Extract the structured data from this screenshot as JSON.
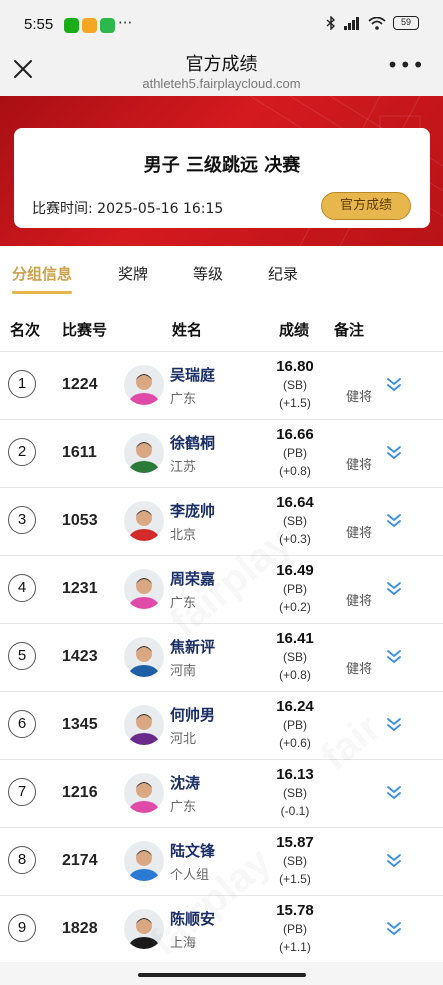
{
  "status_bar": {
    "time": "5:55",
    "more": "···",
    "battery": "59",
    "app_colors": [
      "#1aad19",
      "#f5a623",
      "#2db84d"
    ]
  },
  "header": {
    "title": "官方成绩",
    "url": "athleteh5.fairplaycloud.com"
  },
  "event": {
    "title": "男子 三级跳远 决赛",
    "time": "比赛时间: 2025-05-16 16:15",
    "official_button": "官方成绩"
  },
  "tabs": [
    "分组信息",
    "奖牌",
    "等级",
    "纪录"
  ],
  "table_headers": {
    "rank": "名次",
    "bib": "比赛号",
    "name": "姓名",
    "result": "成绩",
    "note": "备注"
  },
  "rows": [
    {
      "rank": "1",
      "bib": "1224",
      "name": "吴瑞庭",
      "team": "广东",
      "mark": "16.80",
      "tag": "(SB)",
      "wind": "(+1.5)",
      "note": "健将",
      "shirt": "#e04aa8"
    },
    {
      "rank": "2",
      "bib": "1611",
      "name": "徐鹤桐",
      "team": "江苏",
      "mark": "16.66",
      "tag": "(PB)",
      "wind": "(+0.8)",
      "note": "健将",
      "shirt": "#2c7a3a"
    },
    {
      "rank": "3",
      "bib": "1053",
      "name": "李庞帅",
      "team": "北京",
      "mark": "16.64",
      "tag": "(SB)",
      "wind": "(+0.3)",
      "note": "健将",
      "shirt": "#d42a2a"
    },
    {
      "rank": "4",
      "bib": "1231",
      "name": "周荣嘉",
      "team": "广东",
      "mark": "16.49",
      "tag": "(PB)",
      "wind": "(+0.2)",
      "note": "健将",
      "shirt": "#e04aa8"
    },
    {
      "rank": "5",
      "bib": "1423",
      "name": "焦新评",
      "team": "河南",
      "mark": "16.41",
      "tag": "(SB)",
      "wind": "(+0.8)",
      "note": "健将",
      "shirt": "#1f5fa8"
    },
    {
      "rank": "6",
      "bib": "1345",
      "name": "何帅男",
      "team": "河北",
      "mark": "16.24",
      "tag": "(PB)",
      "wind": "(+0.6)",
      "note": "",
      "shirt": "#6a2a8a"
    },
    {
      "rank": "7",
      "bib": "1216",
      "name": "沈涛",
      "team": "广东",
      "mark": "16.13",
      "tag": "(SB)",
      "wind": "(-0.1)",
      "note": "",
      "shirt": "#e04aa8"
    },
    {
      "rank": "8",
      "bib": "2174",
      "name": "陆文锋",
      "team": "个人组",
      "mark": "15.87",
      "tag": "(SB)",
      "wind": "(+1.5)",
      "note": "",
      "shirt": "#2a7ad4"
    },
    {
      "rank": "9",
      "bib": "1828",
      "name": "陈顺安",
      "team": "上海",
      "mark": "15.78",
      "tag": "(PB)",
      "wind": "(+1.1)",
      "note": "",
      "shirt": "#1a1a1a"
    }
  ],
  "colors": {
    "banner_red": "#c8161d",
    "accent_gold": "#e6b64c",
    "name_blue": "#1a2e66",
    "expand_blue": "#3b8fe0"
  },
  "watermark": "fairplay"
}
